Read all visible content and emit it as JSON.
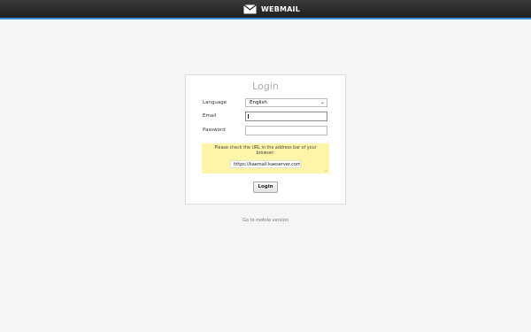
{
  "header": {
    "brand": "WEBMAIL"
  },
  "login": {
    "title": "Login",
    "language_label": "Language",
    "language_value": "English",
    "email_label": "Email",
    "email_value": "",
    "password_label": "Password",
    "password_value": "",
    "notice_text": "Please check the URL in the address bar of your browser:",
    "notice_url": "https://kaemail.kaeserver.com/",
    "login_button": "Login"
  },
  "footer": {
    "mobile_link": "Go to mobile version"
  },
  "colors": {
    "accent": "#3d8fd6",
    "notice_bg": "#fff5a8",
    "topbar": "#262626"
  },
  "icons": {
    "brand": "envelope-icon",
    "language_select": "chevron-down-icon"
  }
}
